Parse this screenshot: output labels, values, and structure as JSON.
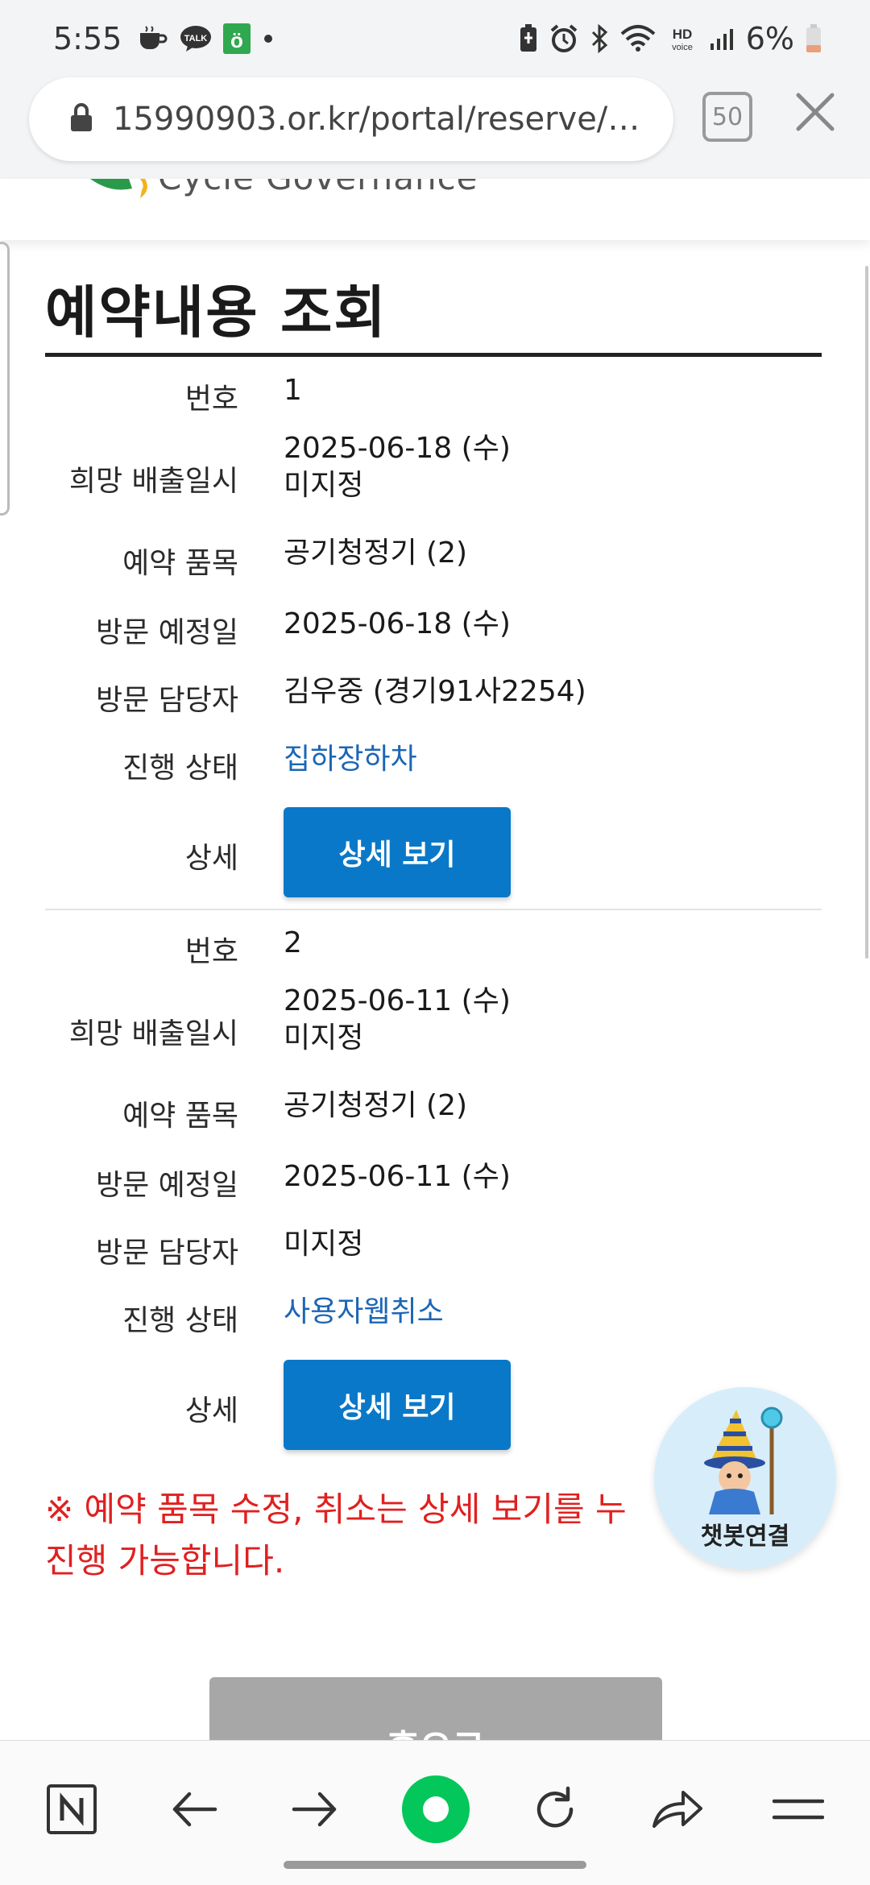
{
  "status_bar": {
    "time": "5:55",
    "notif_icons": [
      "coffee-icon",
      "kakaotalk-icon",
      "green-app-icon",
      "dot-icon"
    ],
    "battery": "6%",
    "battery_color": "#e9a07a"
  },
  "browser": {
    "url": "15990903.or.kr/portal/reserve/se…",
    "tab_count": "50"
  },
  "site": {
    "logo_text": "Cycle Governance"
  },
  "page": {
    "title": "예약내용 조회"
  },
  "records": [
    {
      "fields": [
        {
          "label": "번호",
          "value": "1"
        },
        {
          "label": "희망 배출일시",
          "value": "2025-06-18 (수)",
          "value2": "미지정"
        },
        {
          "label": "예약 품목",
          "value": "공기청정기 (2)"
        },
        {
          "label": "방문 예정일",
          "value": "2025-06-18 (수)"
        },
        {
          "label": "방문 담당자",
          "value": "김우중 (경기91사2254)"
        },
        {
          "label": "진행 상태",
          "value": "집하장하차"
        },
        {
          "label": "상세",
          "value": "상세 보기"
        }
      ]
    },
    {
      "fields": [
        {
          "label": "번호",
          "value": "2"
        },
        {
          "label": "희망 배출일시",
          "value": "2025-06-11 (수)",
          "value2": "미지정"
        },
        {
          "label": "예약 품목",
          "value": "공기청정기 (2)"
        },
        {
          "label": "방문 예정일",
          "value": "2025-06-11 (수)"
        },
        {
          "label": "방문 담당자",
          "value": "미지정"
        },
        {
          "label": "진행 상태",
          "value": "사용자웹취소"
        },
        {
          "label": "상세",
          "value": "상세 보기"
        }
      ]
    }
  ],
  "notice": {
    "line1": "※ 예약 품목 수정, 취소는 상세 보기를 누",
    "line2": "진행 가능합니다."
  },
  "home_button": "홈으로",
  "chatbot": {
    "label": "챗봇연결"
  },
  "bottom_nav": [
    "naver-n-icon",
    "back-arrow-icon",
    "forward-arrow-icon",
    "green-circle-icon",
    "refresh-icon",
    "share-icon",
    "menu-icon"
  ],
  "colors": {
    "accent_button": "#0a78c8",
    "status_link": "#1b66b6",
    "notice_red": "#e02020",
    "naver_green": "#03c75a"
  }
}
